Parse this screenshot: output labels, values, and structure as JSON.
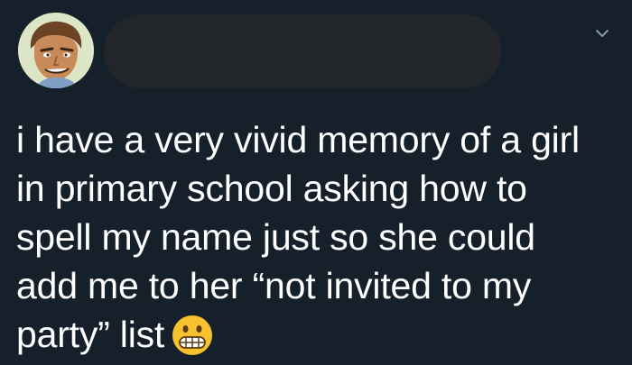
{
  "tweet": {
    "lines": [
      "i have a very vivid memory of a girl",
      "in primary school asking how to",
      "spell my name just so she could",
      "add me to her “not invited to my",
      "party” list"
    ],
    "emoji": "grimacing-face-emoji",
    "avatar": "cartoon-face-avatar",
    "menu_icon": "chevron-down-icon"
  },
  "colors": {
    "background": "#15202b",
    "text": "#ffffff",
    "redacted_name": "#22262b",
    "chevron": "#8899a6",
    "emoji_face": "#f7c22e"
  }
}
